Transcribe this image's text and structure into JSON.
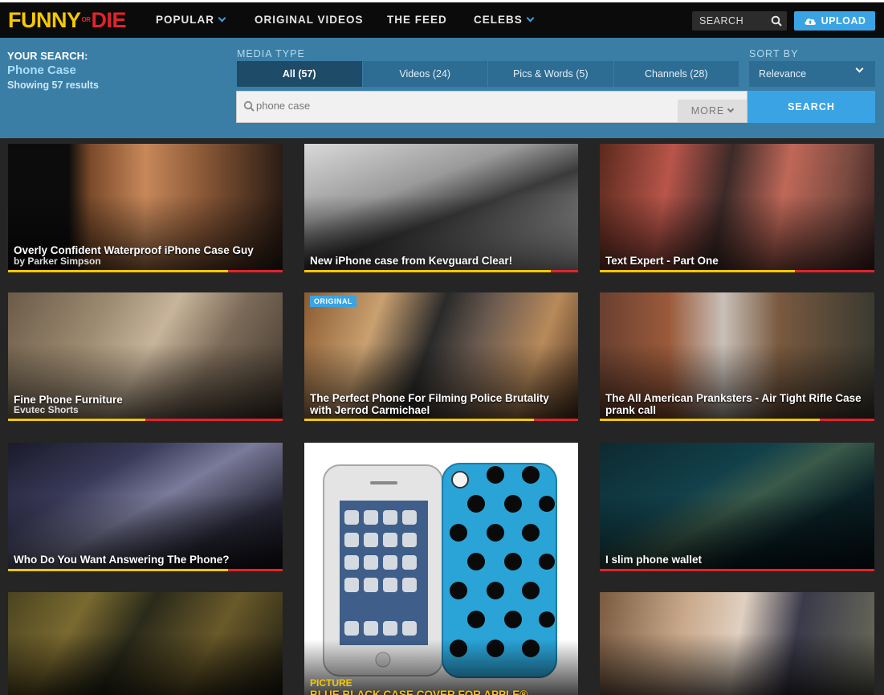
{
  "brand": {
    "logo_left": "FUNNY",
    "logo_or_top": "OR",
    "logo_right": "DIE"
  },
  "nav": {
    "popular": "POPULAR",
    "original_videos": "ORIGINAL VIDEOS",
    "the_feed": "THE FEED",
    "celebs": "CELEBS",
    "search_label": "SEARCH",
    "upload_label": "UPLOAD"
  },
  "search_summary": {
    "label": "YOUR SEARCH:",
    "term": "Phone Case",
    "showing": "Showing 57 results"
  },
  "media_type": {
    "label": "MEDIA TYPE",
    "tabs": [
      {
        "label": "All (57)",
        "active": true
      },
      {
        "label": "Videos (24)",
        "active": false
      },
      {
        "label": "Pics & Words (5)",
        "active": false
      },
      {
        "label": "Channels (28)",
        "active": false
      }
    ]
  },
  "sort": {
    "label": "SORT BY",
    "value": "Relevance"
  },
  "search_box": {
    "value": "phone case",
    "more_label": "MORE",
    "button_label": "SEARCH"
  },
  "results": [
    {
      "title": "Overly Confident Waterproof iPhone Case Guy",
      "byline": "by Parker Simpson",
      "progress": 0.8
    },
    {
      "title": "New iPhone case from Kevguard Clear!",
      "byline": "",
      "progress": 0.9
    },
    {
      "title": "Text Expert - Part One",
      "byline": "",
      "progress": 0.71
    },
    {
      "title": "Fine Phone Furniture",
      "byline": "Evutec Shorts",
      "progress": 0.5
    },
    {
      "title": "The Perfect Phone For Filming Police Brutality with Jerrod Carmichael",
      "byline": "",
      "badge": "ORIGINAL",
      "progress": 0.84
    },
    {
      "title": "The All American Pranksters - Air Tight Rifle Case prank call",
      "byline": "",
      "progress": 0.8
    },
    {
      "title": "Who Do You Want Answering The Phone?",
      "byline": "",
      "progress": 0.8
    },
    {
      "title": "BLUE BLACK CASE COVER FOR APPLE®",
      "tag": "PICTURE",
      "byline": ""
    },
    {
      "title": "I slim phone wallet",
      "byline": "",
      "progress": 0.0
    },
    {
      "title": "",
      "byline": ""
    },
    {
      "title": "",
      "byline": ""
    }
  ],
  "colors": {
    "accent": "#3aa3e3",
    "band": "#3a7ea6",
    "yellow": "#f5c800",
    "red": "#e2232a"
  }
}
